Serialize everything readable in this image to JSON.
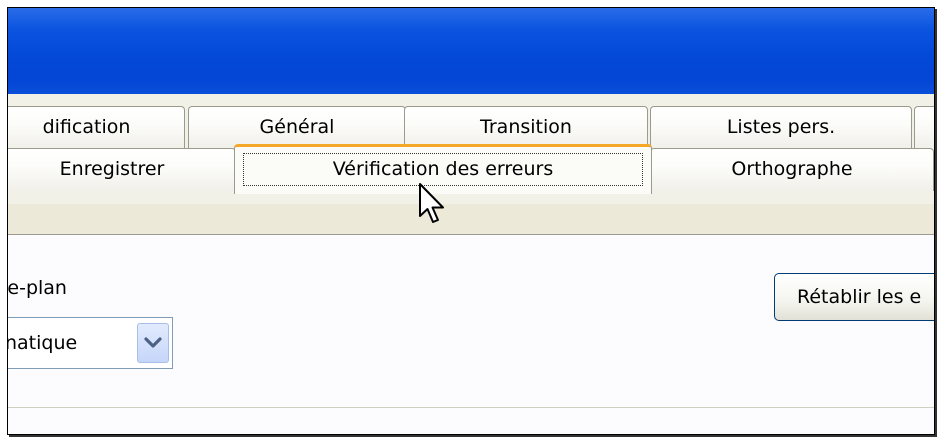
{
  "tabs_row1": [
    {
      "label": "dification"
    },
    {
      "label": "Général"
    },
    {
      "label": "Transition"
    },
    {
      "label": "Listes pers."
    }
  ],
  "tabs_row2": [
    {
      "label": "Enregistrer"
    },
    {
      "label": "Vérification des erreurs"
    },
    {
      "label": "Orthographe"
    }
  ],
  "panel": {
    "section_label": "re-plan",
    "select_value": "natique",
    "reset_button_label": "Rétablir les e"
  },
  "icons": {
    "dropdown": "chevron-down-icon",
    "cursor": "mouse-pointer-icon"
  },
  "colors": {
    "title_bar": "#0348d7",
    "active_tab_accent": "#f5a828"
  }
}
